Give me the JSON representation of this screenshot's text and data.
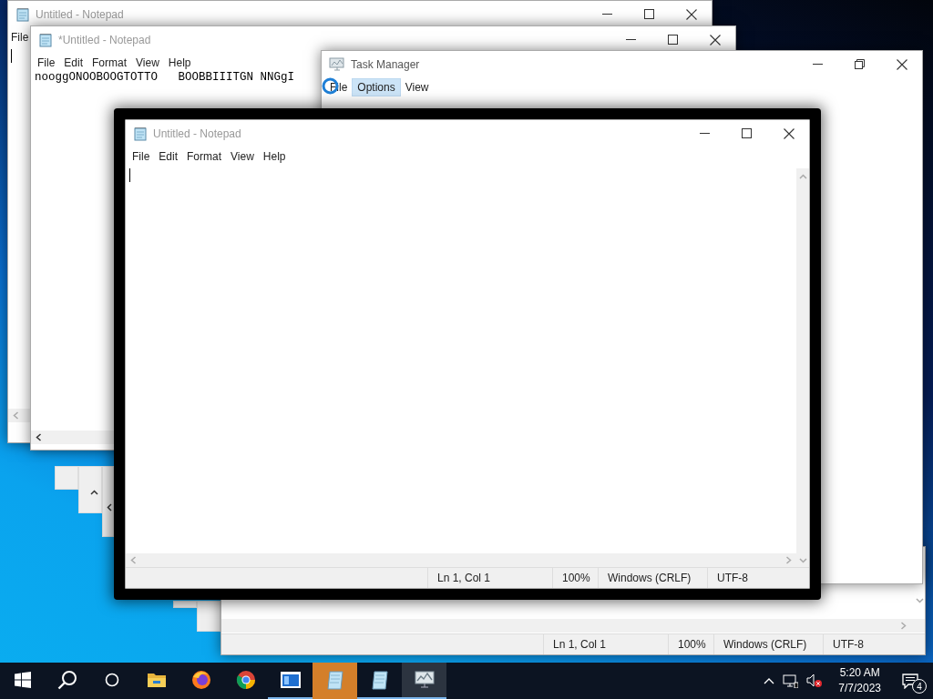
{
  "notepad_back": {
    "title": "Untitled - Notepad",
    "menu": [
      "File"
    ]
  },
  "notepad_middle": {
    "title": "*Untitled - Notepad",
    "menu": [
      "File",
      "Edit",
      "Format",
      "View",
      "Help"
    ],
    "text": "nooggONOOBOOGTOTTO   BOOBBIIITGN NNGgI"
  },
  "notepad_lower": {
    "status_bar": [
      "Ln 1, Col 1",
      "100%",
      "Windows (CRLF)",
      "UTF-8"
    ]
  },
  "task_manager": {
    "title": "Task Manager",
    "menu": [
      {
        "label": "File",
        "selected": false
      },
      {
        "label": "Options",
        "selected": true
      },
      {
        "label": "View",
        "selected": false
      }
    ]
  },
  "notepad_front": {
    "title": "Untitled - Notepad",
    "menu": [
      "File",
      "Edit",
      "Format",
      "View",
      "Help"
    ],
    "status_bar": [
      "Ln 1, Col 1",
      "100%",
      "Windows (CRLF)",
      "UTF-8"
    ]
  },
  "taskbar": {
    "items": [
      {
        "kind": "start"
      },
      {
        "kind": "search"
      },
      {
        "kind": "task-view"
      },
      {
        "kind": "folder",
        "running": false,
        "flashing": false,
        "active": false
      },
      {
        "kind": "firefox",
        "running": false,
        "flashing": false,
        "active": false
      },
      {
        "kind": "chrome",
        "running": false,
        "flashing": false,
        "active": false
      },
      {
        "kind": "app",
        "running": true,
        "flashing": false,
        "active": false
      },
      {
        "kind": "notepad",
        "running": false,
        "flashing": true,
        "active": false
      },
      {
        "kind": "notepad",
        "running": true,
        "flashing": false,
        "active": false
      },
      {
        "kind": "task-manager",
        "running": true,
        "flashing": false,
        "active": true
      }
    ],
    "time": "5:20 AM",
    "date": "7/7/2023",
    "notifications": "4"
  }
}
